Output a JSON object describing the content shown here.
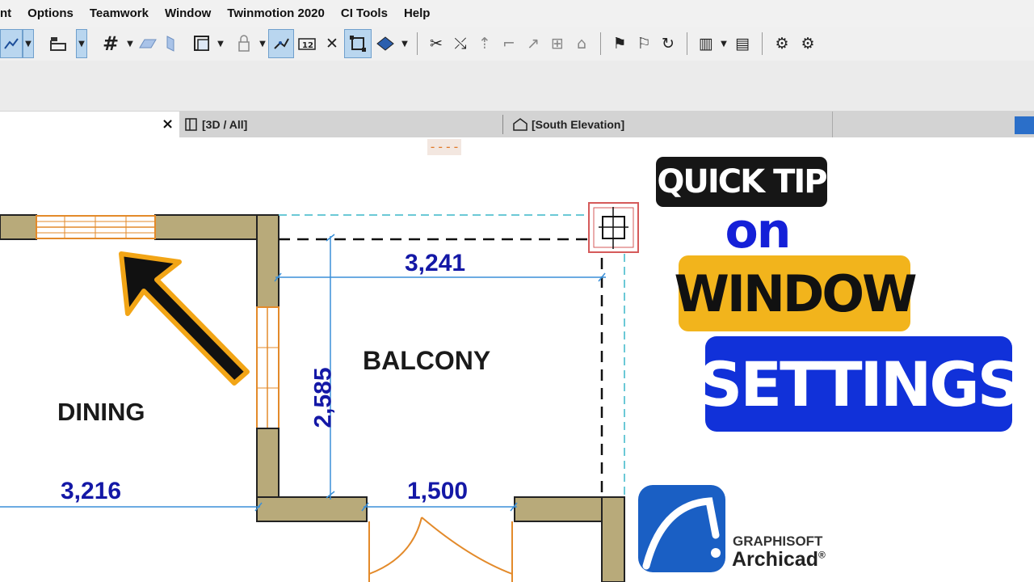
{
  "menubar": {
    "items": [
      "nt",
      "Options",
      "Teamwork",
      "Window",
      "Twinmotion 2020",
      "CI Tools",
      "Help"
    ]
  },
  "tabs": {
    "close_glyph": "×",
    "tab_3d": "[3D / All]",
    "tab_elevation": "[South Elevation]",
    "drag_handle": "----"
  },
  "plan": {
    "rooms": {
      "dining": "DINING",
      "balcony": "BALCONY"
    },
    "dimensions": {
      "top": "3,241",
      "vertical": "2,585",
      "dining_bottom": "3,216",
      "door": "1,500"
    }
  },
  "overlay": {
    "quick_tip": "QUICK TIP",
    "on": "on",
    "window": "WINDOW",
    "settings": "SETTINGS"
  },
  "logo": {
    "company": "GRAPHISOFT",
    "product": "Archicad",
    "registered": "®"
  },
  "colors": {
    "wall_fill": "#b8aa7a",
    "dimension_blue": "#1418a6",
    "window_orange": "#e38a2a",
    "arrow_outline": "#f2a516",
    "tip_yellow": "#f2b41c",
    "settings_blue": "#1131d9",
    "logo_blue": "#1a5fc4",
    "active_tool": "#b9d6ef"
  }
}
